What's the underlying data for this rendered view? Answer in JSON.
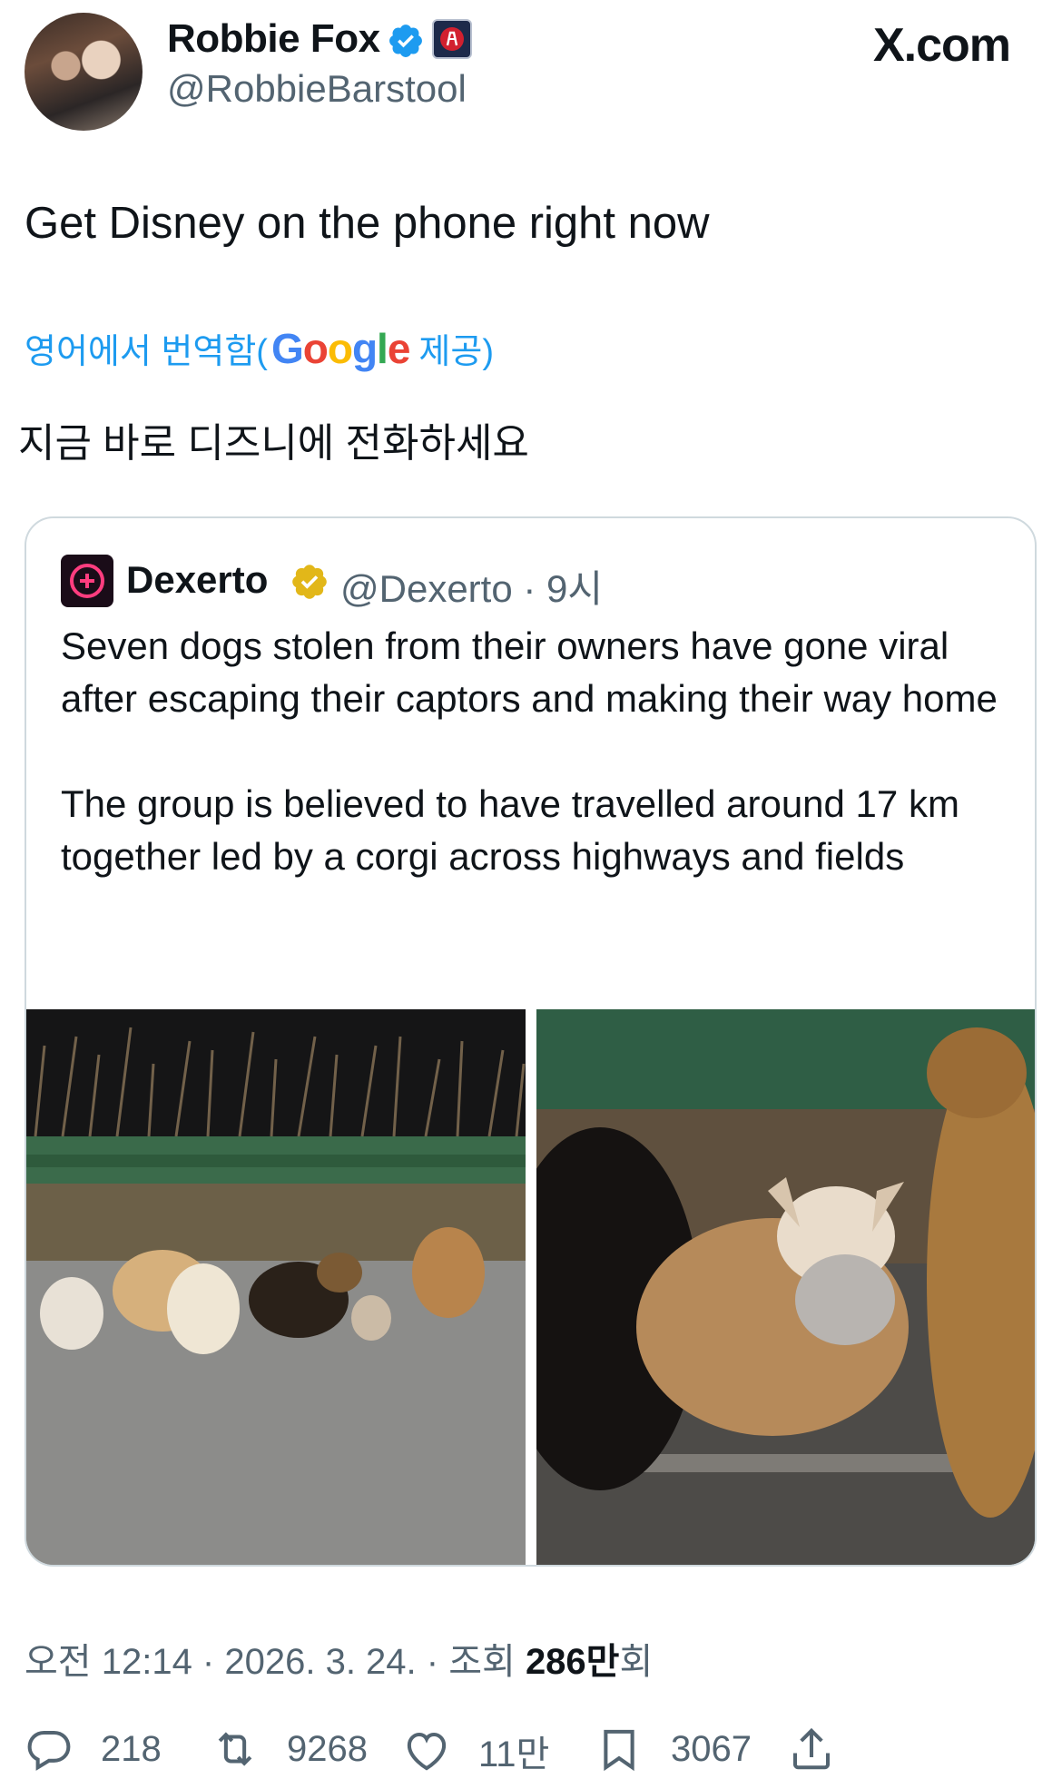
{
  "author": {
    "name": "Robbie Fox",
    "handle": "@RobbieBarstool",
    "verified": true,
    "affiliate_icon": "barstool-logo-icon"
  },
  "site_label": "X.com",
  "tweet_text": "Get Disney on the phone right now",
  "translation": {
    "prefix": "영어에서 번역함(",
    "provider": "Google",
    "suffix": "제공)",
    "text": "지금 바로 디즈니에 전화하세요"
  },
  "quoted": {
    "name": "Dexerto",
    "handle": "@Dexerto",
    "time": "9시",
    "verified_color": "#e2b719",
    "paragraphs": [
      "Seven dogs stolen from their owners have gone viral after escaping their captors and making their way home",
      "The group is believed to have travelled around 17 km together led by a corgi across highways and fields"
    ],
    "media": [
      "dogs-on-road-photo",
      "corgi-closeup-photo"
    ]
  },
  "meta": {
    "time": "오전 12:14",
    "date": "2026. 3. 24.",
    "views_label": "조회",
    "views_value": "286만",
    "views_suffix": "회"
  },
  "actions": {
    "replies": "218",
    "reposts": "9268",
    "likes": "11만",
    "bookmarks": "3067"
  },
  "colors": {
    "accent": "#1d9bf0",
    "secondary_text": "#536471",
    "border": "#cfd9de"
  }
}
